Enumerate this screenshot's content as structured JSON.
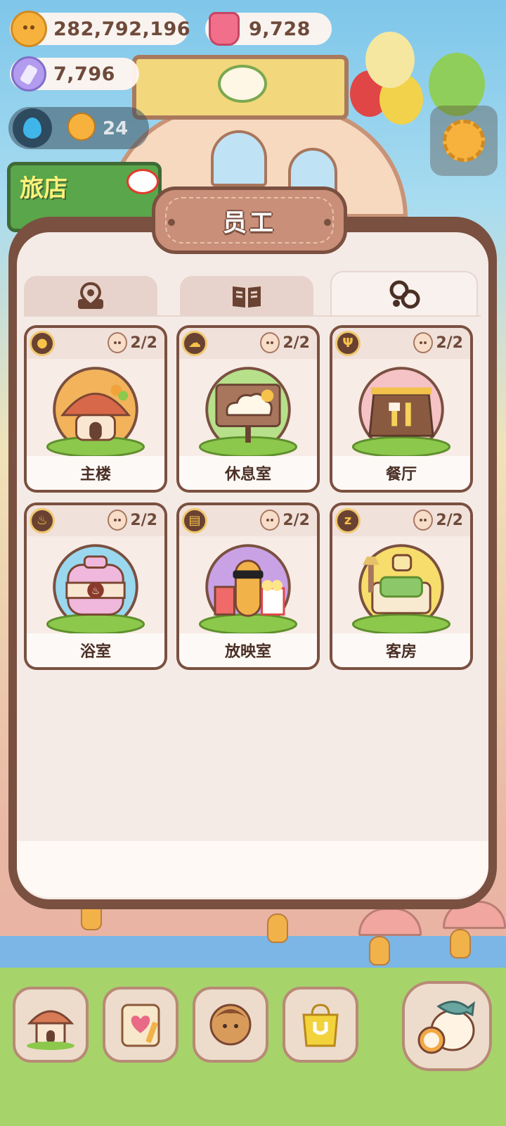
{
  "hud": {
    "coins": "282,792,196",
    "gems": "9,728",
    "crystals": "7,796",
    "water_count": "24"
  },
  "event_sign": {
    "text": "旅店"
  },
  "modal": {
    "title": "员工",
    "tabs": [
      {
        "icon": "location-pin-icon",
        "active": false
      },
      {
        "icon": "open-book-icon",
        "active": false
      },
      {
        "icon": "staff-group-icon",
        "active": true
      }
    ],
    "rooms": [
      {
        "name": "主楼",
        "staff": "2/2",
        "category_icon": "cookie-icon",
        "art": "mushroom-house",
        "disc_color": "#f2b35a"
      },
      {
        "name": "休息室",
        "staff": "2/2",
        "category_icon": "cloud-icon",
        "art": "cloud-sign",
        "disc_color": "#b7e08a"
      },
      {
        "name": "餐厅",
        "staff": "2/2",
        "category_icon": "fork-knife-icon",
        "art": "restaurant-sign",
        "disc_color": "#f5c2c6"
      },
      {
        "name": "浴室",
        "staff": "2/2",
        "category_icon": "steam-icon",
        "art": "bath-tub",
        "disc_color": "#9ad8ef"
      },
      {
        "name": "放映室",
        "staff": "2/2",
        "category_icon": "clapperboard-icon",
        "art": "cinema-popcorn",
        "disc_color": "#c9a2e6"
      },
      {
        "name": "客房",
        "staff": "2/2",
        "category_icon": "sleep-icon",
        "art": "bed",
        "disc_color": "#f6dd6c"
      }
    ]
  },
  "bottom_nav": [
    {
      "name": "build-house-icon"
    },
    {
      "name": "notebook-heart-icon"
    },
    {
      "name": "cookie-character-icon"
    },
    {
      "name": "shop-bag-icon"
    },
    {
      "name": "fish-alarm-icon"
    }
  ],
  "colors": {
    "panel_border": "#7a5040",
    "panel_bg": "#f5ebe6",
    "card_bg": "#fdf9f6",
    "text_brown": "#4a2f25"
  }
}
